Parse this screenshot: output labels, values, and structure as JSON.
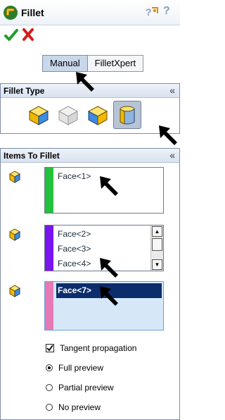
{
  "window": {
    "title": "Fillet",
    "help_hint": "?"
  },
  "tabs": [
    {
      "label": "Manual",
      "active": true
    },
    {
      "label": "FilletXpert",
      "active": false
    }
  ],
  "fillet_type": {
    "header": "Fillet Type",
    "collapse_symbol": "≈",
    "options": [
      "constant-radius-icon",
      "variable-radius-icon",
      "face-fillet-icon",
      "full-round-icon"
    ],
    "selected_index": 3
  },
  "items_to_fillet": {
    "header": "Items To Fillet",
    "collapse_symbol": "≈",
    "set1": {
      "color": "#22c23c",
      "items": [
        "Face<1>"
      ]
    },
    "set2": {
      "color": "#7a14f0",
      "items": [
        "Face<2>",
        "Face<3>",
        "Face<4>"
      ]
    },
    "set3": {
      "color": "#e67ab6",
      "items": [
        "Face<7>"
      ],
      "selected_index": 0
    },
    "tangent_propagation": {
      "label": "Tangent propagation",
      "checked": true
    },
    "preview": {
      "options": [
        "Full preview",
        "Partial preview",
        "No preview"
      ],
      "selected_index": 0
    }
  }
}
